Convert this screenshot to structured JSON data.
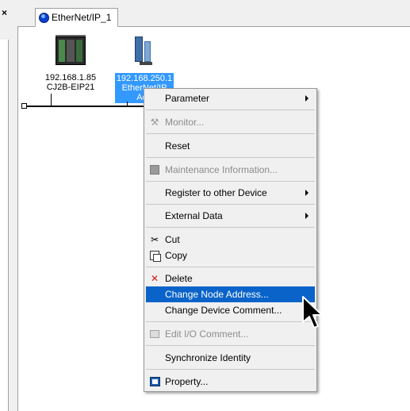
{
  "left_pane": {
    "close_glyph": "×"
  },
  "tab": {
    "label": "EtherNet/IP_1",
    "icon": "network-globe-icon"
  },
  "devices": [
    {
      "address": "192.168.1.85",
      "model": "CJ2B-EIP21",
      "icon": "plc-icon"
    },
    {
      "address": "192.168.250.1",
      "model_partial": "EtherNet/IP",
      "model_partial2": "Ada",
      "icon": "adapter-icon",
      "selected": true
    }
  ],
  "context_menu": {
    "items": [
      {
        "id": "parameter",
        "label": "Parameter",
        "underline": "P",
        "submenu": true,
        "enabled": true
      },
      {
        "id": "monitor",
        "label": "Monitor...",
        "underline": "M",
        "enabled": false,
        "icon": "monitor-icon"
      },
      {
        "id": "reset",
        "label": "Reset",
        "underline": "R",
        "enabled": true
      },
      {
        "id": "maintenance",
        "label": "Maintenance Information...",
        "underline": "M",
        "enabled": false,
        "icon": "maintenance-icon"
      },
      {
        "id": "register",
        "label": "Register to other Device",
        "submenu": true,
        "enabled": true
      },
      {
        "id": "external",
        "label": "External Data",
        "submenu": true,
        "enabled": true
      },
      {
        "id": "cut",
        "label": "Cut",
        "underline": "t",
        "enabled": true,
        "icon": "scissors-icon"
      },
      {
        "id": "copy",
        "label": "Copy",
        "underline": "C",
        "enabled": true,
        "icon": "copy-icon"
      },
      {
        "id": "delete",
        "label": "Delete",
        "underline": "D",
        "enabled": true,
        "icon": "delete-x-icon"
      },
      {
        "id": "change_node_address",
        "label": "Change Node Address...",
        "underline": "A",
        "enabled": true,
        "highlighted": true
      },
      {
        "id": "change_device_comment",
        "label": "Change Device Comment...",
        "underline": "m",
        "enabled": true
      },
      {
        "id": "edit_io",
        "label": "Edit I/O Comment...",
        "underline": "I",
        "enabled": false,
        "icon": "edit-comment-icon"
      },
      {
        "id": "sync_identity",
        "label": "Synchronize Identity",
        "underline": "I",
        "enabled": true
      },
      {
        "id": "property",
        "label": "Property...",
        "underline": "P",
        "enabled": true,
        "icon": "property-icon"
      }
    ]
  },
  "colors": {
    "menu_highlight": "#0a63c9",
    "selection": "#3399ff",
    "delete_icon": "#cc1a1a"
  }
}
